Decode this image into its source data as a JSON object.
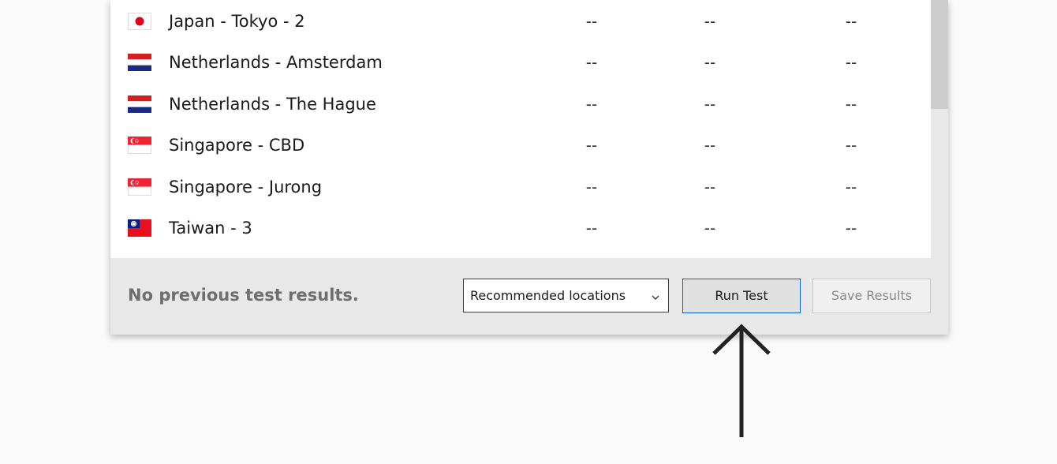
{
  "locations": [
    {
      "flag": "japan",
      "name": "Japan - Tokyo - 2",
      "values": [
        "--",
        "--",
        "--"
      ]
    },
    {
      "flag": "netherlands",
      "name": "Netherlands - Amsterdam",
      "values": [
        "--",
        "--",
        "--"
      ]
    },
    {
      "flag": "netherlands",
      "name": "Netherlands - The Hague",
      "values": [
        "--",
        "--",
        "--"
      ]
    },
    {
      "flag": "singapore",
      "name": "Singapore - CBD",
      "values": [
        "--",
        "--",
        "--"
      ]
    },
    {
      "flag": "singapore",
      "name": "Singapore - Jurong",
      "values": [
        "--",
        "--",
        "--"
      ]
    },
    {
      "flag": "taiwan",
      "name": "Taiwan - 3",
      "values": [
        "--",
        "--",
        "--"
      ]
    }
  ],
  "footer": {
    "status_text": "No previous test results.",
    "location_select": "Recommended locations",
    "run_test_label": "Run Test",
    "save_results_label": "Save Results"
  },
  "colors": {
    "run_button_border": "#0a64c8",
    "arrow": "#222222"
  },
  "icons": {
    "dropdown": "chevron-down-icon",
    "pointer": "arrow-up-icon"
  }
}
